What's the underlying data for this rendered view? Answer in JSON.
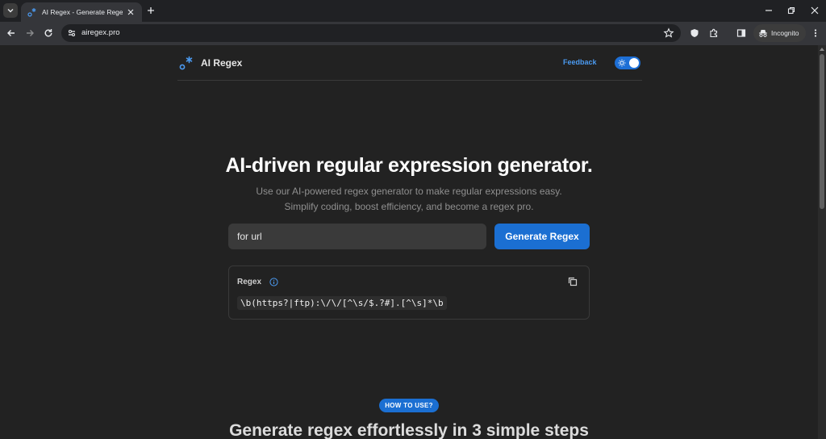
{
  "browser": {
    "tab": {
      "title": "AI Regex - Generate Regex Easily"
    },
    "address": {
      "url": "airegex.pro"
    },
    "profile": {
      "label": "Incognito"
    }
  },
  "header": {
    "brand": "AI Regex",
    "feedback_label": "Feedback",
    "theme_toggle_on": true
  },
  "hero": {
    "title": "AI-driven regular expression generator.",
    "subtitle_line1": "Use our AI-powered regex generator to make regular expressions easy.",
    "subtitle_line2": "Simplify coding, boost efficiency, and become a regex pro."
  },
  "generator": {
    "input_value": "for url",
    "button_label": "Generate Regex"
  },
  "result": {
    "label": "Regex",
    "regex": "\\b(https?|ftp):\\/\\/[^\\s/$.?#].[^\\s]*\\b"
  },
  "how_to": {
    "pill": "HOW TO USE?",
    "title": "Generate regex effortlessly in 3 simple steps"
  },
  "colors": {
    "accent": "#1b6fd2",
    "link": "#4b9af0",
    "page_bg": "#222222",
    "chrome_bg": "#202124"
  }
}
